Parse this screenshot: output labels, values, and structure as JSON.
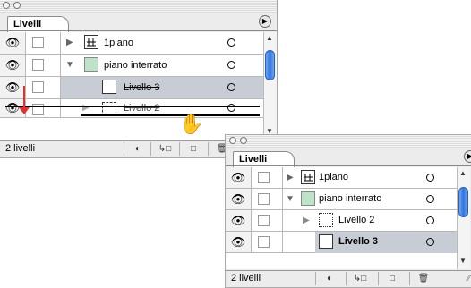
{
  "back_panel": {
    "tab_label": "Livelli",
    "status_text": "2 livelli",
    "rows": [
      {
        "name": "1piano",
        "type": "group",
        "expanded": false
      },
      {
        "name": "piano interrato",
        "type": "group",
        "expanded": true
      },
      {
        "name": "Livello 3",
        "type": "layer",
        "selected": true
      },
      {
        "name": "Livello 2",
        "type": "layer",
        "selected": false
      }
    ]
  },
  "front_panel": {
    "tab_label": "Livelli",
    "status_text": "2 livelli",
    "rows": [
      {
        "name": "1piano",
        "type": "group",
        "expanded": false
      },
      {
        "name": "piano interrato",
        "type": "group",
        "expanded": true
      },
      {
        "name": "Livello 2",
        "type": "layer",
        "expanded": false
      },
      {
        "name": "Livello 3",
        "type": "layer",
        "selected": true
      }
    ]
  },
  "icons": {
    "eye": "eye-icon",
    "triangle_right": "triangle-right-icon",
    "triangle_down": "triangle-down-icon",
    "hand": "grab-hand-icon",
    "menu": "panel-menu-icon",
    "trash": "trash-icon"
  },
  "colors": {
    "selection": "#c8ccd4",
    "scroll_thumb": "#2f74e0",
    "drag_arrow": "#e03030"
  }
}
